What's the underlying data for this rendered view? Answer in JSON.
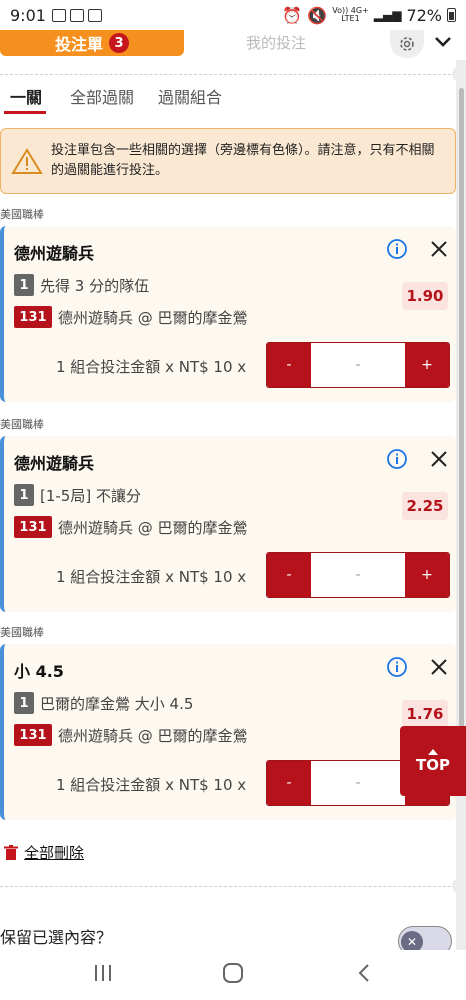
{
  "status": {
    "time": "9:01",
    "net_top": "Vo)) 4G+",
    "net_bottom": "LTE1",
    "battery": "72%"
  },
  "header": {
    "betslip_tab": "投注單",
    "betslip_count": "3",
    "mybets_tab": "我的投注"
  },
  "subtabs": [
    "一關",
    "全部過關",
    "過關組合"
  ],
  "warning": {
    "text": "投注單包含一些相關的選擇（旁邊標有色條）。請注意，只有不相關的過關能進行投注。"
  },
  "bets": [
    {
      "league": "美國職棒",
      "title": "德州遊騎兵",
      "sel_no": "1",
      "selection": "先得 3 分的隊伍",
      "odds": "1.90",
      "event_no": "131",
      "event": "德州遊騎兵 @ 巴爾的摩金鶯",
      "stake_label": "1 組合投注金額 x NT$ 10 x",
      "minus": "-",
      "stake_value": "-",
      "plus": "+"
    },
    {
      "league": "美國職棒",
      "title": "德州遊騎兵",
      "sel_no": "1",
      "selection": "[1-5局] 不讓分",
      "odds": "2.25",
      "event_no": "131",
      "event": "德州遊騎兵 @ 巴爾的摩金鶯",
      "stake_label": "1 組合投注金額 x NT$ 10 x",
      "minus": "-",
      "stake_value": "-",
      "plus": "+"
    },
    {
      "league": "美國職棒",
      "title": "小 4.5",
      "sel_no": "1",
      "selection": "巴爾的摩金鶯 大小 4.5",
      "odds": "1.76",
      "event_no": "131",
      "event": "德州遊騎兵 @ 巴爾的摩金鶯",
      "stake_label": "1 組合投注金額 x NT$ 10 x",
      "minus": "-",
      "stake_value": "-",
      "plus": "+"
    }
  ],
  "footer": {
    "delete_all": "全部刪除",
    "keep_selections": "保留已選內容？",
    "top_button": "TOP"
  },
  "icons": {
    "accent": "#b5121b",
    "brand_orange": "#f5901e",
    "info": "#1a73e8"
  }
}
